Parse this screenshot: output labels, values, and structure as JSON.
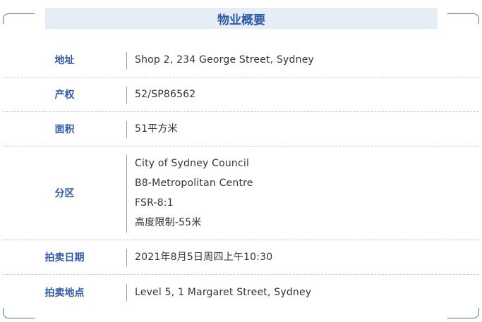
{
  "title": "物业概要",
  "rows": [
    {
      "label": "地址",
      "values": [
        "Shop 2, 234 George Street, Sydney"
      ]
    },
    {
      "label": "产权",
      "values": [
        "52/SP86562"
      ]
    },
    {
      "label": "面积",
      "values": [
        "51平方米"
      ]
    },
    {
      "label": "分区",
      "values": [
        "City of Sydney Council",
        "B8-Metropolitan Centre",
        "FSR-8:1",
        "高度限制-55米"
      ]
    },
    {
      "label": "拍卖日期",
      "values": [
        "2021年8月5日周四上午10:30"
      ]
    },
    {
      "label": "拍卖地点",
      "values": [
        "Level 5, 1 Margaret Street, Sydney"
      ]
    }
  ],
  "colors": {
    "accent": "#2e5aa8",
    "title_background": "#e6edf7",
    "text": "#333333"
  }
}
